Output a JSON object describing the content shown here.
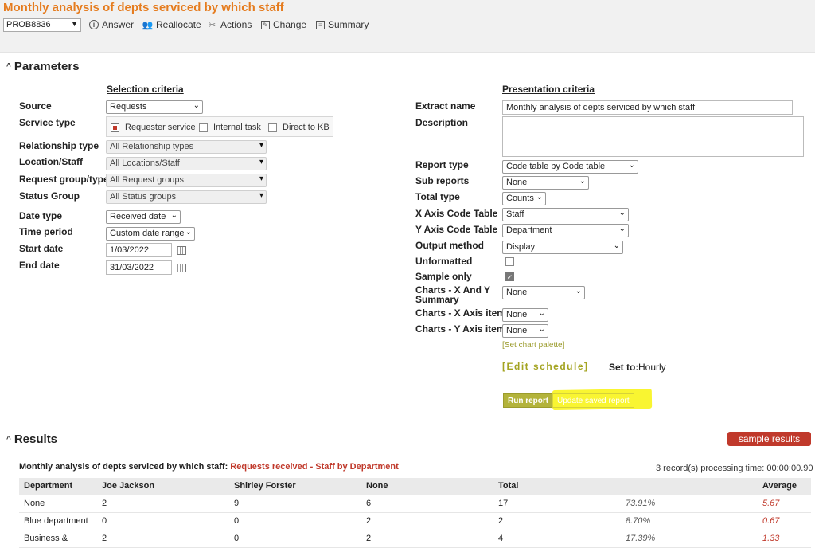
{
  "header": {
    "title": "Monthly analysis of depts serviced by which staff",
    "record": "PROB8836",
    "toolbar": [
      {
        "label": "Answer",
        "icon": "info-icon"
      },
      {
        "label": "Reallocate",
        "icon": "users-icon"
      },
      {
        "label": "Actions",
        "icon": "tools-icon"
      },
      {
        "label": "Change",
        "icon": "edit-icon"
      },
      {
        "label": "Summary",
        "icon": "summary-icon"
      }
    ]
  },
  "parameters": {
    "title": "Parameters",
    "selection_heading": "Selection criteria",
    "presentation_heading": "Presentation criteria",
    "source": {
      "label": "Source",
      "value": "Requests"
    },
    "service_type": {
      "label": "Service type",
      "options": [
        {
          "label": "Requester service",
          "state": "selected"
        },
        {
          "label": "Internal task",
          "state": "unchecked"
        },
        {
          "label": "Direct to KB",
          "state": "unchecked"
        }
      ]
    },
    "relationship_type": {
      "label": "Relationship type",
      "value": "All Relationship types"
    },
    "location_staff": {
      "label": "Location/Staff",
      "value": "All Locations/Staff"
    },
    "request_group": {
      "label": "Request group/type",
      "value": "All Request groups"
    },
    "status_group": {
      "label": "Status Group",
      "value": "All Status groups"
    },
    "date_type": {
      "label": "Date type",
      "value": "Received date"
    },
    "time_period": {
      "label": "Time period",
      "value": "Custom date range"
    },
    "start_date": {
      "label": "Start date",
      "value": "1/03/2022"
    },
    "end_date": {
      "label": "End date",
      "value": "31/03/2022"
    },
    "extract_name": {
      "label": "Extract name",
      "value": "Monthly analysis of depts serviced by which staff"
    },
    "description": {
      "label": "Description",
      "value": ""
    },
    "report_type": {
      "label": "Report type",
      "value": "Code table by Code table"
    },
    "sub_reports": {
      "label": "Sub reports",
      "value": "None"
    },
    "total_type": {
      "label": "Total type",
      "value": "Counts"
    },
    "x_axis": {
      "label": "X Axis Code Table",
      "value": "Staff"
    },
    "y_axis": {
      "label": "Y Axis Code Table",
      "value": "Department"
    },
    "output_method": {
      "label": "Output method",
      "value": "Display"
    },
    "unformatted": {
      "label": "Unformatted",
      "checked": false
    },
    "sample_only": {
      "label": "Sample only",
      "checked": true
    },
    "charts_xy": {
      "label_line1": "Charts - X And Y",
      "label_line2": "Summary",
      "value": "None"
    },
    "charts_x": {
      "label": "Charts - X Axis items",
      "value": "None"
    },
    "charts_y": {
      "label": "Charts - Y Axis items",
      "value": "None"
    },
    "chart_palette_link": "[Set chart palette]",
    "edit_schedule": "[Edit schedule]",
    "set_to_label": "Set to:",
    "set_to_value": "Hourly",
    "run_report": "Run report",
    "update_saved_report": "Update saved report"
  },
  "results": {
    "title": "Results",
    "sample_badge": "sample results",
    "report_title": "Monthly analysis of depts serviced by which staff:",
    "report_subtitle": "Requests received - Staff by Department",
    "meta": "3 record(s)  processing time: 00:00:00.90",
    "columns": [
      "Department",
      "Joe Jackson",
      "Shirley Forster",
      "None",
      "Total",
      "",
      "Average"
    ],
    "rows": [
      [
        "None",
        "2",
        "9",
        "6",
        "17",
        "73.91%",
        "5.67"
      ],
      [
        "Blue department",
        "0",
        "0",
        "2",
        "2",
        "8.70%",
        "0.67"
      ],
      [
        "Business &",
        "2",
        "0",
        "2",
        "4",
        "17.39%",
        "1.33"
      ]
    ]
  },
  "colors": {
    "title_orange": "#e57c1f",
    "olive": "#b3b33b",
    "badge_red": "#c0392b",
    "highlight_yellow": "#f9f531"
  }
}
